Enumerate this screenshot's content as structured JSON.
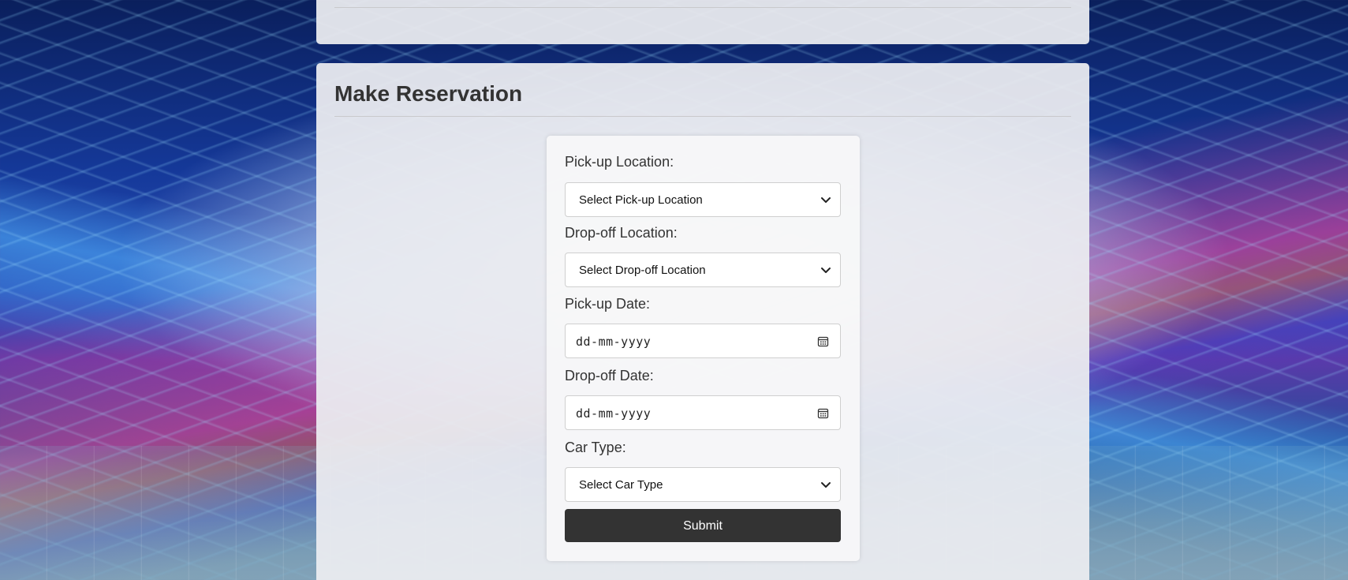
{
  "reservation": {
    "title": "Make Reservation",
    "fields": {
      "pickup_location": {
        "label": "Pick-up Location:",
        "selected": "Select Pick-up Location"
      },
      "dropoff_location": {
        "label": "Drop-off Location:",
        "selected": "Select Drop-off Location"
      },
      "pickup_date": {
        "label": "Pick-up Date:",
        "placeholder": "dd-mm-yyyy"
      },
      "dropoff_date": {
        "label": "Drop-off Date:",
        "placeholder": "dd-mm-yyyy"
      },
      "car_type": {
        "label": "Car Type:",
        "selected": "Select Car Type"
      }
    },
    "submit_label": "Submit"
  },
  "icons": {
    "select_arrow": "chevron-down-icon",
    "date_picker": "calendar-icon"
  },
  "colors": {
    "button_bg": "#333333",
    "panel_bg": "#ebecf0",
    "text": "#333333"
  }
}
